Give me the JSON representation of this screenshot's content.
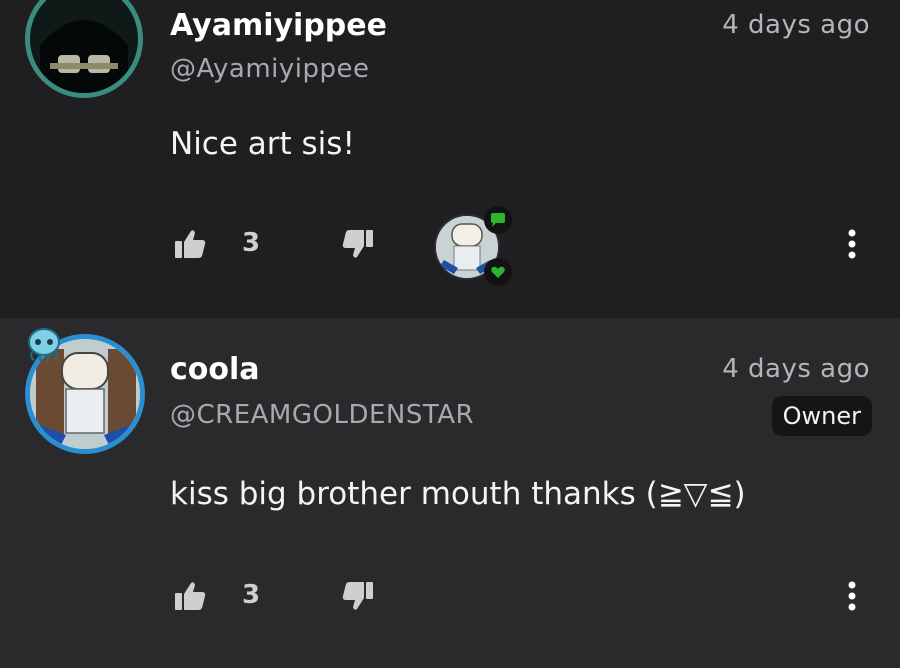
{
  "comments": [
    {
      "display_name": "Ayamiyippee",
      "handle": "@Ayamiyippee",
      "time": "4 days ago",
      "text": "Nice art sis!",
      "likes": "3"
    },
    {
      "display_name": "coola",
      "handle": "@CREAMGOLDENSTAR",
      "time": "4 days ago",
      "badge": "Owner",
      "text": "kiss big brother mouth thanks (≧▽≦)",
      "likes": "3"
    }
  ],
  "colors": {
    "accent_green": "#2fb52a",
    "icon_gray": "#cfcfd2",
    "avatar_ring_teal": "#3a8c80",
    "avatar_ring_blue": "#2a8fd0"
  },
  "icons": {
    "like": "thumbs-up-icon",
    "dislike": "thumbs-down-icon",
    "more": "more-vertical-icon",
    "reply": "speech-bubble-icon",
    "heart": "heart-icon"
  }
}
